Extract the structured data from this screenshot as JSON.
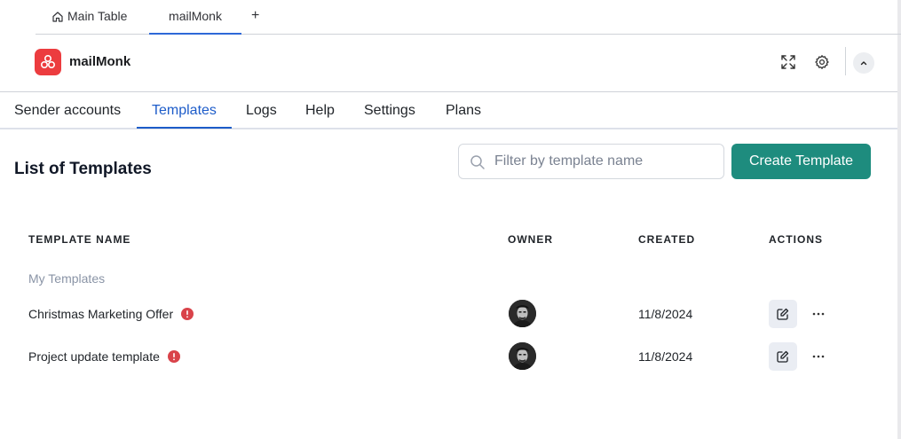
{
  "board_tabs": {
    "main_table": "Main Table",
    "active": "mailMonk",
    "add": "+"
  },
  "header": {
    "app_name": "mailMonk",
    "logo_color": "#ec3c3f"
  },
  "nav": {
    "tabs": [
      {
        "label": "Sender accounts"
      },
      {
        "label": "Templates",
        "active": true
      },
      {
        "label": "Logs"
      },
      {
        "label": "Help"
      },
      {
        "label": "Settings"
      },
      {
        "label": "Plans"
      }
    ],
    "accent": "#1d5cc9"
  },
  "page": {
    "title": "List of Templates",
    "search_placeholder": "Filter by template name",
    "create_button": "Create Template",
    "create_button_color": "#1e8c7e"
  },
  "table": {
    "columns": [
      "TEMPLATE NAME",
      "OWNER",
      "CREATED",
      "ACTIONS"
    ],
    "group_label": "My Templates",
    "rows": [
      {
        "name": "Christmas Marketing Offer",
        "created": "11/8/2024",
        "warning": true
      },
      {
        "name": "Project update template",
        "created": "11/8/2024",
        "warning": true
      }
    ],
    "warning_color": "#d9434a"
  },
  "icons": {
    "home": "home-icon",
    "expand": "expand-icon",
    "settings": "gear-icon",
    "collapse": "chevron-up-icon",
    "search": "search-icon",
    "warning": "exclamation-icon",
    "edit": "edit-icon",
    "more": "more-horizontal-icon"
  }
}
